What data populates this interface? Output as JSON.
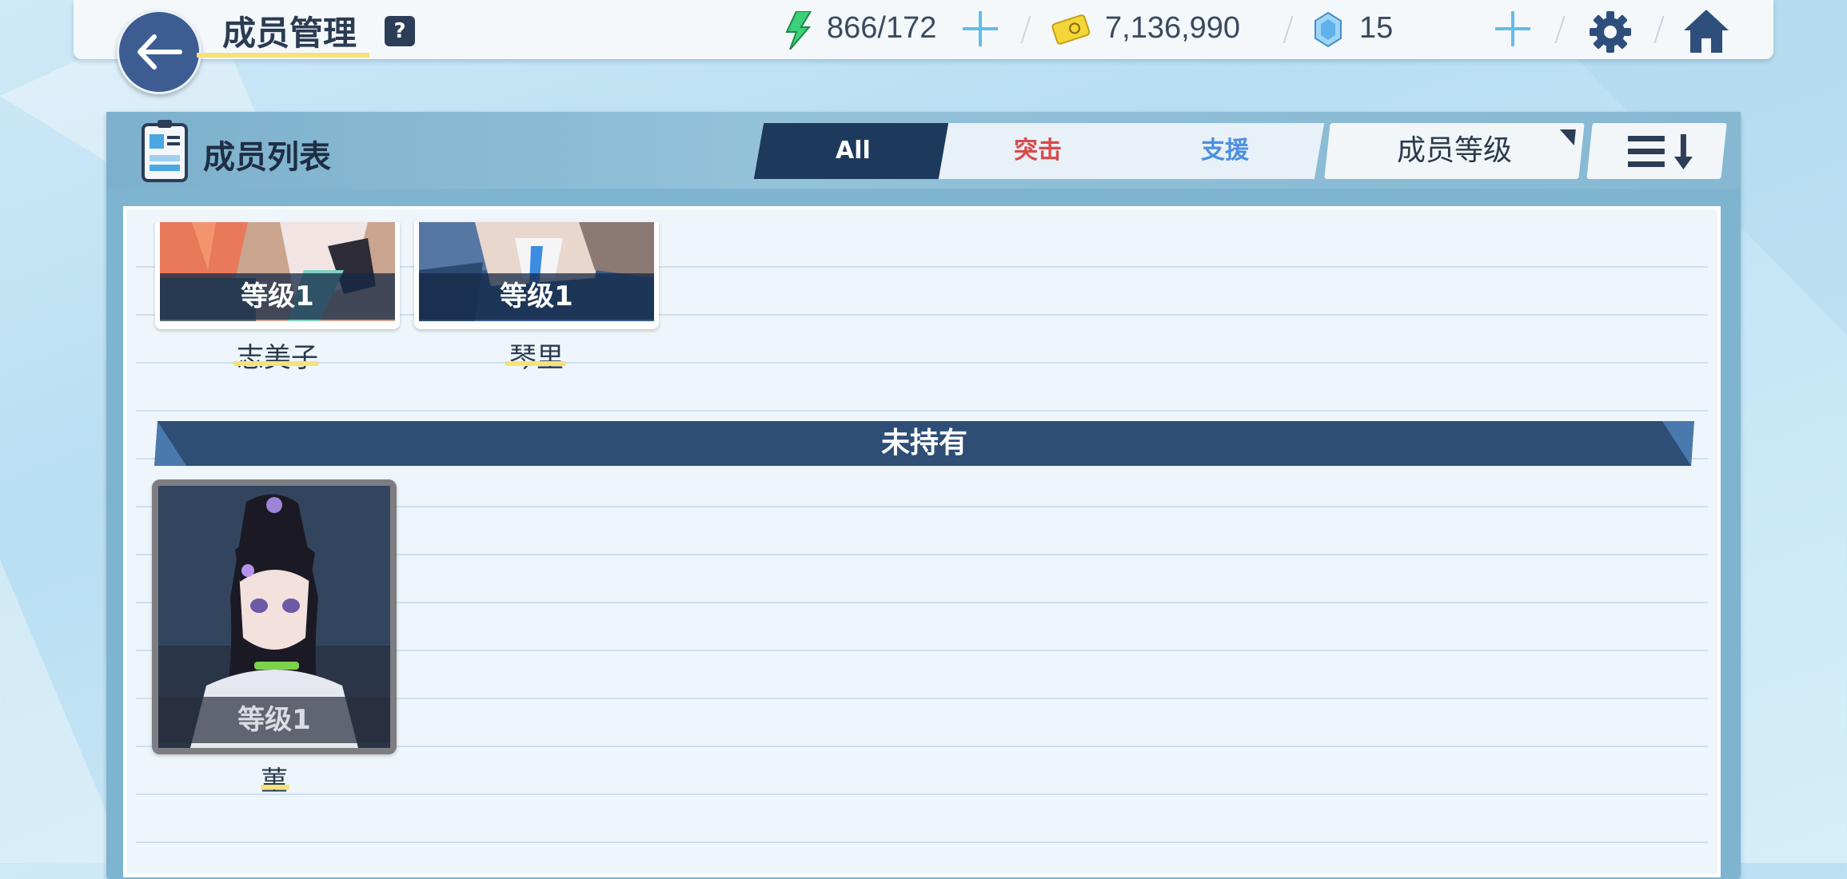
{
  "header": {
    "title": "成员管理",
    "help_label": "?",
    "energy": "866/172",
    "credits": "7,136,990",
    "gems": "15"
  },
  "panel": {
    "list_title": "成员列表",
    "tabs": [
      {
        "label": "All",
        "active": true
      },
      {
        "label": "突击",
        "color": "#d94b4b"
      },
      {
        "label": "支援",
        "color": "#4b8fe0"
      }
    ],
    "sort_label": "成员等级"
  },
  "members_owned": [
    {
      "name": "志美子",
      "level": "等级1"
    },
    {
      "name": "琴里",
      "level": "等级1"
    }
  ],
  "section_unowned": "未持有",
  "members_unowned": [
    {
      "name": "菫",
      "level": "等级1"
    }
  ],
  "colors": {
    "accent_dark": "#1d3a5c",
    "attack": "#d94b4b",
    "support": "#4b8fe0",
    "underline": "#f6e27a"
  }
}
